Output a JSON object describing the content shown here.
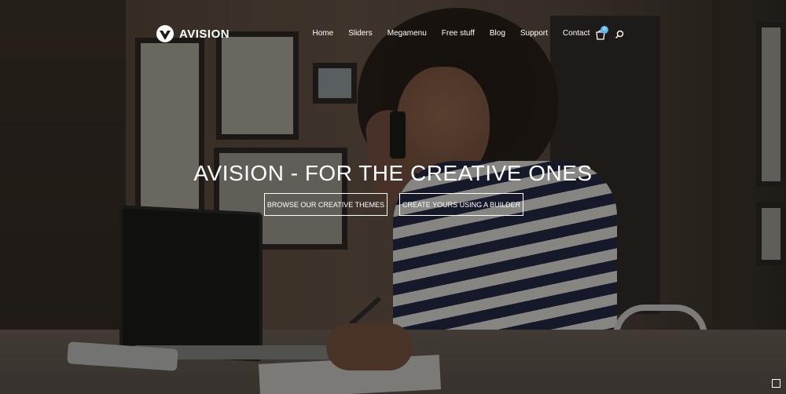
{
  "header": {
    "logo_text": "AVISION",
    "nav": [
      {
        "label": "Home"
      },
      {
        "label": "Sliders"
      },
      {
        "label": "Megamenu"
      },
      {
        "label": "Free stuff"
      },
      {
        "label": "Blog"
      },
      {
        "label": "Support"
      },
      {
        "label": "Contact"
      }
    ],
    "cart_count": "0",
    "icons": {
      "cart": "shopping-bag-icon",
      "search": "search-icon",
      "logo": "logo-icon"
    }
  },
  "hero": {
    "title": "AVISION - FOR THE CREATIVE ONES",
    "buttons": [
      {
        "label": "BROWSE OUR CREATIVE THEMES"
      },
      {
        "label": "CREATE YOURS USING A BUILDER"
      }
    ]
  },
  "colors": {
    "badge": "#5ab6e8",
    "text": "#ffffff"
  },
  "corner": {
    "icon": "square-icon"
  }
}
